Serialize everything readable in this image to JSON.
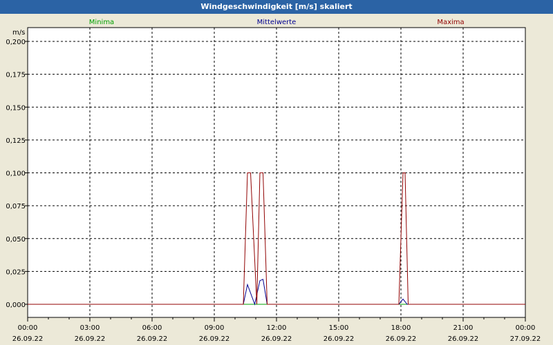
{
  "window": {
    "title": "Windgeschwindigkeit [m/s] skaliert"
  },
  "chart_data": {
    "type": "line",
    "ylabel": "m/s",
    "ylim": [
      0,
      0.2
    ],
    "yticks": [
      "0,000",
      "0,025",
      "0,050",
      "0,075",
      "0,100",
      "0,125",
      "0,150",
      "0,175",
      "0,200"
    ],
    "ytick_values": [
      0,
      0.025,
      0.05,
      0.075,
      0.1,
      0.125,
      0.15,
      0.175,
      0.2
    ],
    "xlim": [
      0,
      24
    ],
    "xticks": [
      {
        "time": "00:00",
        "date": "26.09.22",
        "hour": 0
      },
      {
        "time": "03:00",
        "date": "26.09.22",
        "hour": 3
      },
      {
        "time": "06:00",
        "date": "26.09.22",
        "hour": 6
      },
      {
        "time": "09:00",
        "date": "26.09.22",
        "hour": 9
      },
      {
        "time": "12:00",
        "date": "26.09.22",
        "hour": 12
      },
      {
        "time": "15:00",
        "date": "26.09.22",
        "hour": 15
      },
      {
        "time": "18:00",
        "date": "26.09.22",
        "hour": 18
      },
      {
        "time": "21:00",
        "date": "26.09.22",
        "hour": 21
      },
      {
        "time": "00:00",
        "date": "27.09.22",
        "hour": 24
      }
    ],
    "grid": true,
    "legend_placement": "top",
    "series": [
      {
        "name": "Minima",
        "color": "#00a000",
        "x": [
          0,
          24
        ],
        "y": [
          0,
          0
        ]
      },
      {
        "name": "Mittelwerte",
        "color": "#000090",
        "x": [
          0,
          10.4,
          10.6,
          10.95,
          11.2,
          11.35,
          11.55,
          17.9,
          18.1,
          18.3,
          24
        ],
        "y": [
          0,
          0,
          0.015,
          0,
          0.018,
          0.019,
          0,
          0,
          0.004,
          0,
          0
        ]
      },
      {
        "name": "Maxima",
        "color": "#900000",
        "x": [
          0,
          10.4,
          10.6,
          10.75,
          11.05,
          11.2,
          11.35,
          11.55,
          17.9,
          18.1,
          18.2,
          18.35,
          24
        ],
        "y": [
          0,
          0,
          0.1,
          0.1,
          0,
          0.1,
          0.1,
          0,
          0,
          0.1,
          0.1,
          0,
          0
        ]
      }
    ]
  }
}
